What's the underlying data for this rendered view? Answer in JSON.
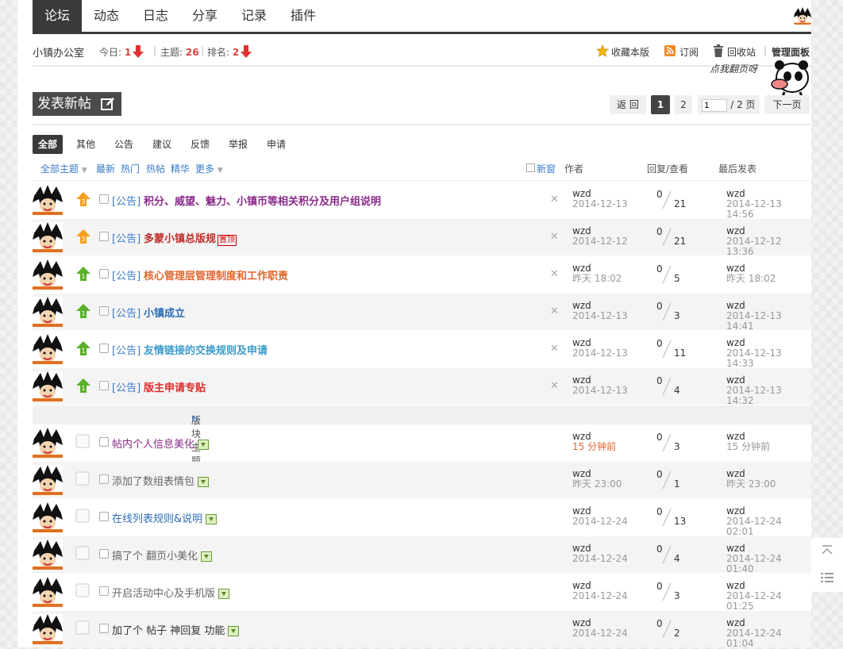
{
  "nav": {
    "tabs": [
      {
        "label": "论坛",
        "active": true
      },
      {
        "label": "动态"
      },
      {
        "label": "日志"
      },
      {
        "label": "分享"
      },
      {
        "label": "记录"
      },
      {
        "label": "插件"
      }
    ]
  },
  "forum": {
    "name": "小镇办公室",
    "today_label": "今日:",
    "today_value": "1",
    "topics_label": "主题:",
    "topics_value": "26",
    "rank_label": "排名:",
    "rank_value": "2",
    "favorite": "收藏本版",
    "subscribe": "订阅",
    "recycle": "回收站",
    "admin": "管理面板",
    "mascot_text": "点我翻页呀"
  },
  "actions": {
    "new_post": "发表新帖",
    "back": "返 回",
    "pages": [
      "1",
      "2"
    ],
    "current_page": "1",
    "page_input": "1",
    "page_total": "/ 2 页",
    "next": "下一页"
  },
  "types": [
    "全部",
    "其他",
    "公告",
    "建议",
    "反馈",
    "举报",
    "申请"
  ],
  "filters": {
    "all": "全部主题",
    "latest": "最新",
    "hot": "热门",
    "hotpost": "热帖",
    "digest": "精华",
    "more": "更多",
    "new_window": "新窗",
    "author": "作者",
    "replies": "回复/查看",
    "last": "最后发表"
  },
  "section_label": "版块主题",
  "pinned_rows": [
    {
      "tag": "[公告]",
      "title": "积分、威望、魅力、小镇币等相关积分及用户组说明",
      "color": "#8a2a8a",
      "level": "3",
      "author": "wzd",
      "date": "2014-12-13",
      "replies": "0",
      "views": "21",
      "last_author": "wzd",
      "last_date": "2014-12-13 14:56"
    },
    {
      "tag": "[公告]",
      "title": "多蒙小镇总版规",
      "color": "#c0302a",
      "level": "3",
      "badge": "置顶",
      "author": "wzd",
      "date": "2014-12-12",
      "replies": "0",
      "views": "21",
      "last_author": "wzd",
      "last_date": "2014-12-12 13:36"
    },
    {
      "tag": "[公告]",
      "title": "核心管理层管理制度和工作职责",
      "color": "#e0662e",
      "level": "1",
      "author": "wzd",
      "date": "昨天 18:02",
      "replies": "0",
      "views": "5",
      "last_author": "wzd",
      "last_date": "昨天 18:02"
    },
    {
      "tag": "[公告]",
      "title": "小镇成立",
      "color": "#2e6db4",
      "level": "1",
      "author": "wzd",
      "date": "2014-12-13",
      "replies": "0",
      "views": "3",
      "last_author": "wzd",
      "last_date": "2014-12-13 14:41"
    },
    {
      "tag": "[公告]",
      "title": "友情链接的交换规则及申请",
      "color": "#3a9ac8",
      "level": "1",
      "author": "wzd",
      "date": "2014-12-13",
      "replies": "0",
      "views": "11",
      "last_author": "wzd",
      "last_date": "2014-12-13 14:33"
    },
    {
      "tag": "[公告]",
      "title": "版主申请专贴",
      "color": "#e02a2a",
      "level": "1",
      "author": "wzd",
      "date": "2014-12-13",
      "replies": "0",
      "views": "4",
      "last_author": "wzd",
      "last_date": "2014-12-13 14:32"
    }
  ],
  "normal_rows": [
    {
      "title": "帖内个人信息美化",
      "color": "#8a2a8a",
      "author": "wzd",
      "date": "15 分钟前",
      "hot": true,
      "replies": "0",
      "views": "3",
      "last_author": "wzd",
      "last_date": "15 分钟前"
    },
    {
      "title": "添加了数组表情包",
      "color": "#666666",
      "author": "wzd",
      "date": "昨天 23:00",
      "replies": "0",
      "views": "1",
      "last_author": "wzd",
      "last_date": "昨天 23:00"
    },
    {
      "title": "在线列表规则&说明",
      "color": "#2e6db4",
      "author": "wzd",
      "date": "2014-12-24",
      "replies": "0",
      "views": "13",
      "last_author": "wzd",
      "last_date": "2014-12-24 02:01"
    },
    {
      "title": "搞了个 翻页小美化",
      "color": "#666666",
      "author": "wzd",
      "date": "2014-12-24",
      "replies": "0",
      "views": "4",
      "last_author": "wzd",
      "last_date": "2014-12-24 01:40"
    },
    {
      "title": "开启活动中心及手机版",
      "color": "#666666",
      "author": "wzd",
      "date": "2014-12-24",
      "replies": "0",
      "views": "3",
      "last_author": "wzd",
      "last_date": "2014-12-24 01:25"
    },
    {
      "title": "加了个 帖子 神回复 功能",
      "color": "#333333",
      "author": "wzd",
      "date": "2014-12-24",
      "replies": "0",
      "views": "2",
      "last_author": "wzd",
      "last_date": "2014-12-24 01:04"
    }
  ]
}
